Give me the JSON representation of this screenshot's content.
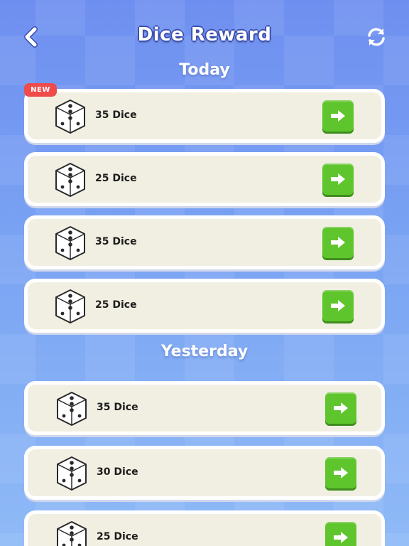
{
  "header": {
    "title": "Dice Reward",
    "back_icon": "chevron-left-icon",
    "refresh_icon": "refresh-icon"
  },
  "sections": [
    {
      "label": "Today",
      "items": [
        {
          "amount": "35 Dice",
          "badge": "NEW"
        },
        {
          "amount": "25 Dice"
        },
        {
          "amount": "35 Dice"
        },
        {
          "amount": "25 Dice"
        }
      ]
    },
    {
      "label": "Yesterday",
      "items": [
        {
          "amount": "35 Dice"
        },
        {
          "amount": "30 Dice"
        },
        {
          "amount": "25 Dice"
        }
      ]
    }
  ],
  "colors": {
    "accent_green": "#5fc52d",
    "badge_red": "#f04a4a",
    "card_bg": "#f1efe2"
  }
}
